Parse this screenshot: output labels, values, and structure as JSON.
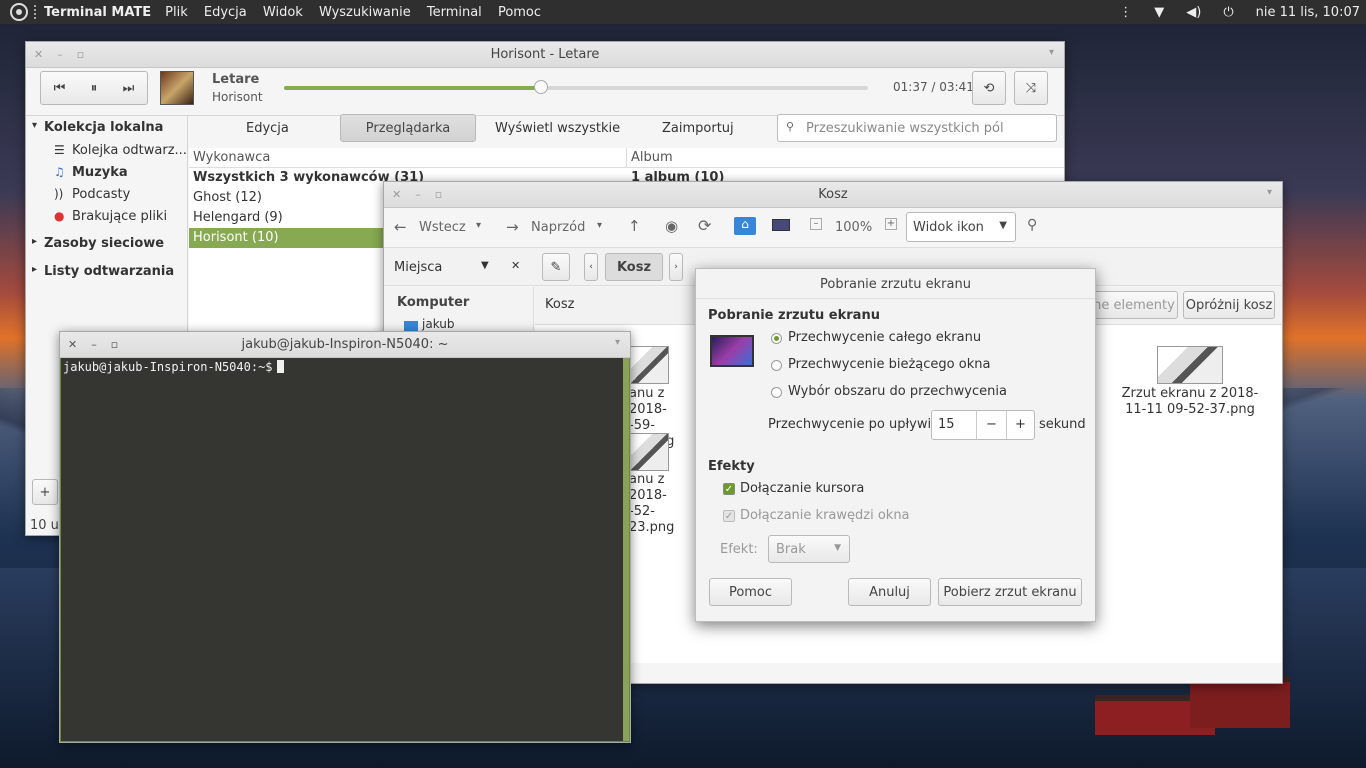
{
  "panel": {
    "app": "Terminal MATE",
    "menus": [
      "Plik",
      "Edycja",
      "Widok",
      "Wyszukiwanie",
      "Terminal",
      "Pomoc"
    ],
    "clock": "nie 11 lis, 10:07"
  },
  "rhythmbox": {
    "title": "Horisont - Letare",
    "track": "Letare",
    "artist": "Horisont",
    "time": "01:37 / 03:41",
    "progress": 0.44,
    "tabs": [
      "Edycja",
      "Przeglądarka",
      "Wyświetl wszystkie",
      "Zaimportuj"
    ],
    "search_placeholder": "Przeszukiwanie wszystkich pól",
    "side": {
      "local": "Kolekcja lokalna",
      "queue": "Kolejka odtwarz...",
      "music": "Muzyka",
      "podcasts": "Podcasty",
      "missing": "Brakujące pliki",
      "network": "Zasoby sieciowe",
      "playlists": "Listy odtwarzania"
    },
    "col_artist": "Wykonawca",
    "col_album": "Album",
    "artists": [
      "Wszystkich 3 wykonawców (31)",
      "Ghost (12)",
      "Helengard (9)",
      "Horisont (10)"
    ],
    "album_first": "1 album (10)",
    "footer_count": "10 ul",
    "add": "+"
  },
  "caja": {
    "title": "Kosz",
    "back": "Wstecz",
    "forward": "Naprzód",
    "zoom": "100%",
    "view": "Widok ikon",
    "places": "Miejsca",
    "crumb": "Kosz",
    "side_header": "Komputer",
    "side_item": "jakub",
    "bar_label": "Kosz",
    "restore": "ne elementy",
    "empty": "Opróżnij kosz",
    "files": [
      {
        "l1": "anu z 2018-",
        "l2": "-59-54.png"
      },
      {
        "l1": "anu z 2018-",
        "l2": "-52-23.png"
      },
      {
        "l1": "Zrzut ekranu z 2018-",
        "l2": "11-11 09-52-37.png"
      }
    ]
  },
  "terminal": {
    "title": "jakub@jakub-Inspiron-N5040: ~",
    "prompt": "jakub@jakub-Inspiron-N5040:~$"
  },
  "dialog": {
    "title": "Pobranie zrzutu ekranu",
    "section1": "Pobranie zrzutu ekranu",
    "opt1": "Przechwycenie całego ekranu",
    "opt2": "Przechwycenie bieżącego okna",
    "opt3": "Wybór obszaru do przechwycenia",
    "delay_label": "Przechwycenie po upływie",
    "delay_value": "15",
    "delay_unit": "sekund",
    "section2": "Efekty",
    "chk1": "Dołączanie kursora",
    "chk2": "Dołączanie krawędzi okna",
    "effect_label": "Efekt:",
    "effect_value": "Brak",
    "help": "Pomoc",
    "cancel": "Anuluj",
    "take": "Pobierz zrzut ekranu"
  }
}
